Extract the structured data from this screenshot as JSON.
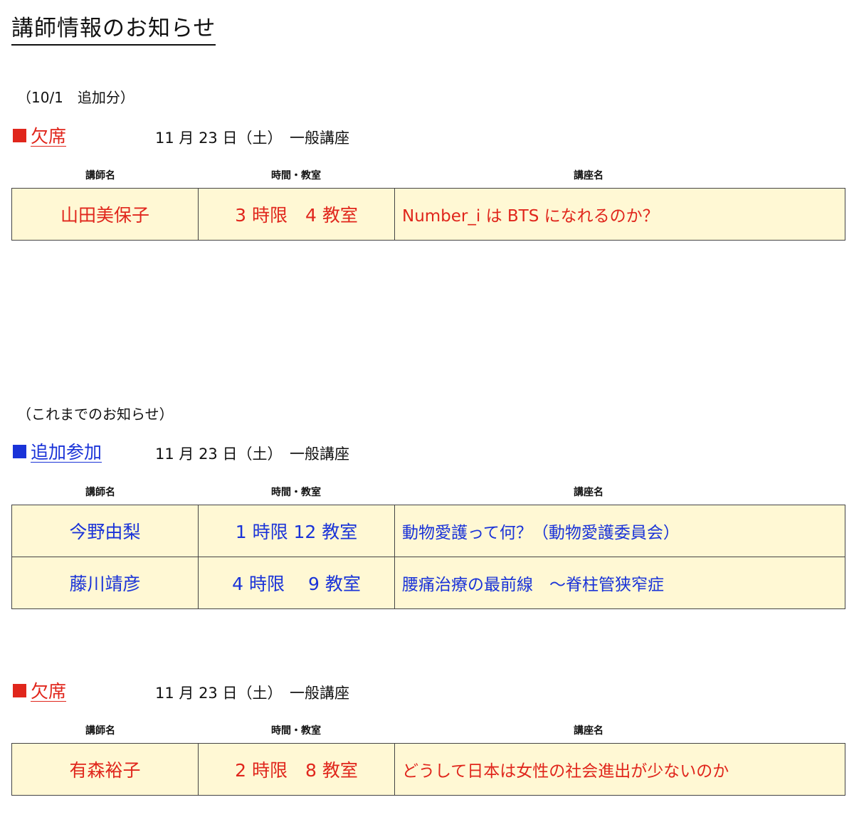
{
  "page": {
    "title": "講師情報のお知らせ"
  },
  "colors": {
    "absent": "#e0261c",
    "added": "#1a33d8",
    "cell_bg": "#fff8d4"
  },
  "sections": [
    {
      "note": "（10/1　追加分）",
      "status": "欠席",
      "date_label": "11 月 23 日（土）　一般講座",
      "headers": {
        "lecturer": "講師名",
        "time_room": "時間・教室",
        "course": "講座名"
      },
      "rows": [
        {
          "lecturer": "山田美保子",
          "time_room": "3 時限　4 教室",
          "course": "Number_i は BTS になれるのか？"
        }
      ]
    },
    {
      "note": "（これまでのお知らせ）",
      "status": "追加参加",
      "date_label": "11 月 23 日（土）　一般講座",
      "headers": {
        "lecturer": "講師名",
        "time_room": "時間・教室",
        "course": "講座名"
      },
      "rows": [
        {
          "lecturer": "今野由梨",
          "time_room": "1 時限  12 教室",
          "course": "動物愛護って何？（動物愛護委員会）"
        },
        {
          "lecturer": "藤川靖彦",
          "time_room": "4 時限　 9 教室",
          "course": "腰痛治療の最前線　～脊柱管狭窄症"
        }
      ]
    },
    {
      "status": "欠席",
      "date_label": "11 月 23 日（土）　一般講座",
      "headers": {
        "lecturer": "講師名",
        "time_room": "時間・教室",
        "course": "講座名"
      },
      "rows": [
        {
          "lecturer": "有森裕子",
          "time_room": "2 時限　8 教室",
          "course": "どうして日本は女性の社会進出が少ないのか"
        }
      ]
    }
  ]
}
